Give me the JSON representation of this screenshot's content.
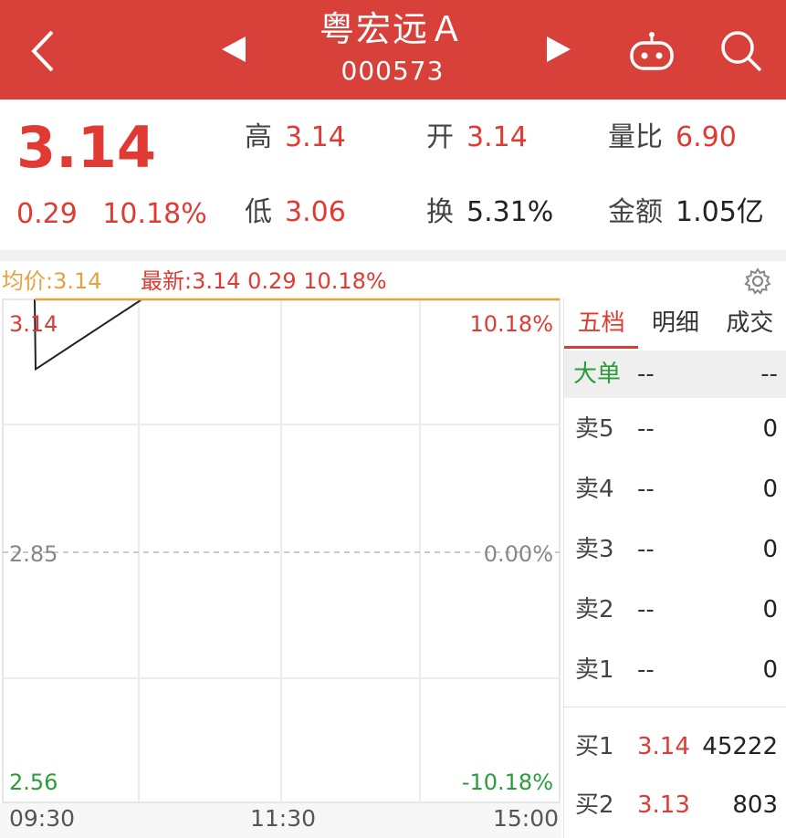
{
  "header": {
    "stock_name": "粤宏远Ａ",
    "stock_code": "000573"
  },
  "quote": {
    "price": "3.14",
    "change": "0.29",
    "change_pct": "10.18%",
    "high_label": "高",
    "high": "3.14",
    "low_label": "低",
    "low": "3.06",
    "open_label": "开",
    "open": "3.14",
    "turnover_label": "换",
    "turnover": "5.31%",
    "vol_ratio_label": "量比",
    "vol_ratio": "6.90",
    "amount_label": "金额",
    "amount": "1.05亿"
  },
  "legend": {
    "avg": "均价:3.14",
    "latest": "最新:3.14  0.29  10.18%"
  },
  "chart": {
    "price_top": "3.14",
    "price_mid": "2.85",
    "price_bottom": "2.56",
    "pct_top": "10.18%",
    "pct_mid": "0.00%",
    "pct_bottom": "-10.18%",
    "time_start": "09:30",
    "time_mid": "11:30",
    "time_end": "15:00"
  },
  "chart_data": {
    "type": "line",
    "y_range": [
      2.56,
      3.14
    ],
    "reference": 2.85,
    "series": [
      {
        "name": "最新",
        "values": [
          3.14,
          3.06,
          3.14,
          3.14,
          3.14,
          3.14,
          3.14
        ]
      },
      {
        "name": "均价",
        "values": [
          3.14,
          3.14,
          3.14,
          3.14,
          3.14,
          3.14,
          3.14
        ]
      }
    ]
  },
  "book": {
    "tabs": [
      "五档",
      "明细",
      "成交"
    ],
    "big_order_label": "大单",
    "big_order_v1": "--",
    "big_order_v2": "--",
    "asks": [
      {
        "label": "卖5",
        "price": "--",
        "volume": "0"
      },
      {
        "label": "卖4",
        "price": "--",
        "volume": "0"
      },
      {
        "label": "卖3",
        "price": "--",
        "volume": "0"
      },
      {
        "label": "卖2",
        "price": "--",
        "volume": "0"
      },
      {
        "label": "卖1",
        "price": "--",
        "volume": "0"
      }
    ],
    "bids": [
      {
        "label": "买1",
        "price": "3.14",
        "volume": "45222"
      },
      {
        "label": "买2",
        "price": "3.13",
        "volume": "803"
      }
    ]
  },
  "colors": {
    "header_bg": "#d8403a",
    "up": "#e03a33",
    "down": "#2a9d3a",
    "avg_line": "#e6a23c"
  },
  "icons": [
    "back-icon",
    "prev-triangle-icon",
    "next-triangle-icon",
    "robot-icon",
    "search-icon",
    "gear-icon"
  ]
}
